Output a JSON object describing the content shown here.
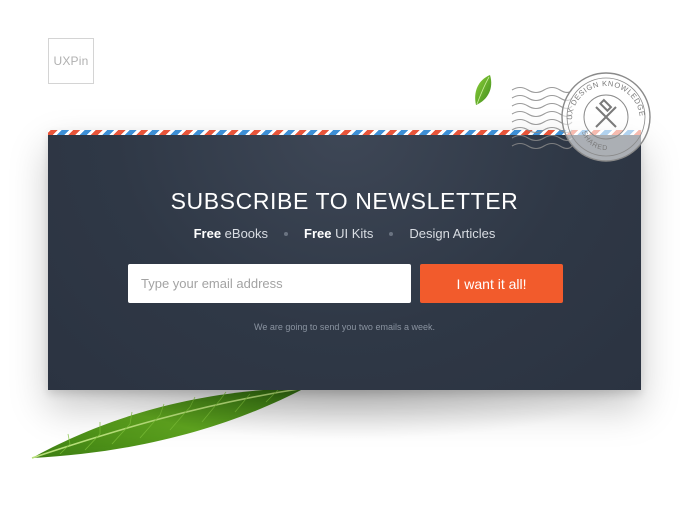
{
  "brand": {
    "logo_text": "UXPin"
  },
  "newsletter": {
    "title": "SUBSCRIBE TO NEWSLETTER",
    "features": [
      {
        "bold": "Free",
        "text": " eBooks"
      },
      {
        "bold": "Free",
        "text": " UI Kits"
      },
      {
        "bold": "",
        "text": "Design Articles"
      }
    ],
    "email_placeholder": "Type your email address",
    "email_value": "",
    "submit_label": "I want it all!",
    "note": "We are going to send you two emails a week."
  },
  "stamp": {
    "top_text": "UX DESIGN KNOWLEDGE",
    "bottom_text": "SHARED"
  },
  "colors": {
    "card_bg": "#2f3846",
    "cta": "#f25b2c",
    "airmail_red": "#e8553a",
    "airmail_blue": "#3d8fd6"
  },
  "icons": [
    "leaf-icon",
    "postmark-stamp-icon"
  ]
}
